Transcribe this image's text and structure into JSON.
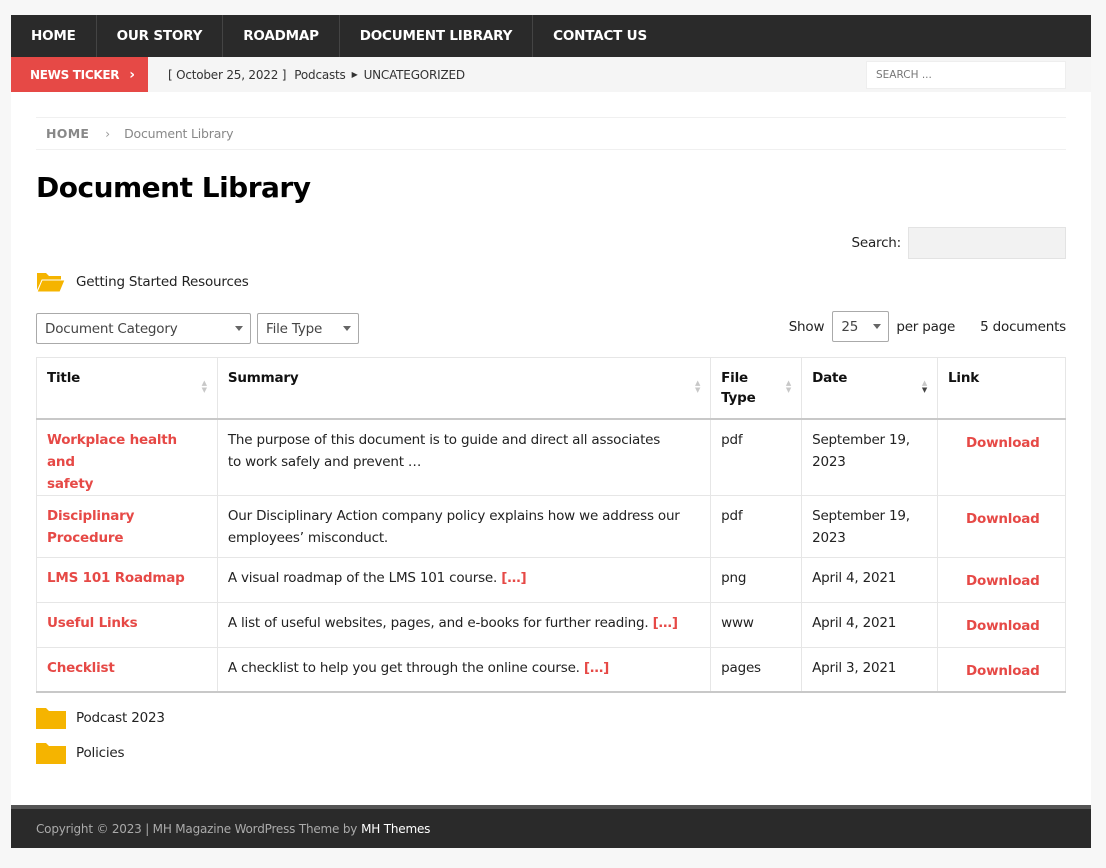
{
  "nav": {
    "items": [
      "HOME",
      "OUR STORY",
      "ROADMAP",
      "DOCUMENT LIBRARY",
      "CONTACT US"
    ]
  },
  "ticker": {
    "label": "NEWS TICKER",
    "date": "[ October 25, 2022 ]",
    "title": "Podcasts",
    "category": "UNCATEGORIZED",
    "search_placeholder": "SEARCH ..."
  },
  "breadcrumb": {
    "home": "HOME",
    "current": "Document Library"
  },
  "page_title": "Document Library",
  "search": {
    "label": "Search:"
  },
  "folders": {
    "top": "Getting Started Resources",
    "bottom": [
      "Podcast 2023",
      "Policies"
    ]
  },
  "filters": {
    "category": "Document Category",
    "file_type": "File Type",
    "show_label": "Show",
    "per_page_value": "25",
    "per_page_label": "per page",
    "count": "5 documents"
  },
  "table": {
    "headers": {
      "title": "Title",
      "summary": "Summary",
      "file_type_1": "File",
      "file_type_2": "Type",
      "date": "Date",
      "link": "Link"
    },
    "rows": [
      {
        "title_1": "Workplace health and",
        "title_2": "safety",
        "summary_1": "The purpose of this document is to guide and direct all associates",
        "summary_2": "to work safely and prevent …",
        "more": "",
        "type": "pdf",
        "date_1": "September 19,",
        "date_2": "2023",
        "link": "Download"
      },
      {
        "title_1": "Disciplinary Procedure",
        "title_2": "",
        "summary_1": "Our Disciplinary Action company policy explains how we address our",
        "summary_2": "employees’ misconduct.",
        "more": "",
        "type": "pdf",
        "date_1": "September 19,",
        "date_2": "2023",
        "link": "Download"
      },
      {
        "title_1": "LMS 101 Roadmap",
        "title_2": "",
        "summary_1": "A visual roadmap of the LMS 101 course. ",
        "summary_2": "",
        "more": "[…]",
        "type": "png",
        "date_1": "April 4, 2021",
        "date_2": "",
        "link": "Download"
      },
      {
        "title_1": "Useful Links",
        "title_2": "",
        "summary_1": "A list of useful websites, pages, and e-books for further reading. ",
        "summary_2": "",
        "more": "[…]",
        "type": "www",
        "date_1": "April 4, 2021",
        "date_2": "",
        "link": "Download"
      },
      {
        "title_1": "Checklist",
        "title_2": "",
        "summary_1": "A checklist to help you get through the online course. ",
        "summary_2": "",
        "more": "[…]",
        "type": "pages",
        "date_1": "April 3, 2021",
        "date_2": "",
        "link": "Download"
      }
    ]
  },
  "footer": {
    "text": "Copyright © 2023 | MH Magazine WordPress Theme by",
    "link": "MH Themes"
  },
  "colors": {
    "accent": "#e64946",
    "dark": "#2a2a2a",
    "folder": "#f5b400"
  }
}
